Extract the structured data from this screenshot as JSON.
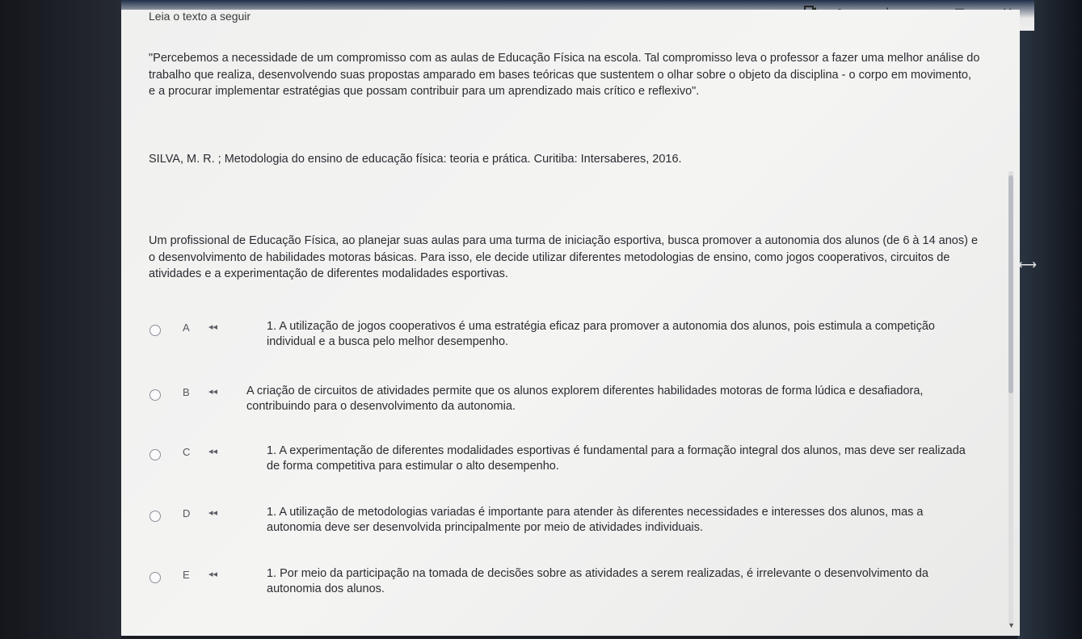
{
  "window": {
    "controls": {
      "cast_icon": "cast-icon",
      "account_icon": "account-icon",
      "menu_icon": "⋮",
      "minimize": "–",
      "maximize": "▢",
      "close": "✕"
    }
  },
  "content": {
    "intro_label": "Leia o texto a seguir",
    "quote": "\"Percebemos a necessidade de um compromisso com as aulas de Educação Física na escola. Tal compromisso leva o professor a fazer uma melhor análise do trabalho que realiza, desenvolvendo suas propostas amparado em bases teóricas que sustentem o olhar sobre o objeto da disciplina - o corpo em movimento, e a procurar implementar estratégias que possam contribuir para um aprendizado mais crítico e reflexivo\".",
    "citation": "SILVA, M. R. ; Metodologia do ensino de educação física: teoria e prática. Curitiba: Intersaberes, 2016.",
    "question": "Um profissional de Educação Física, ao planejar suas aulas para uma turma de iniciação esportiva, busca promover a autonomia dos alunos (de 6 à 14 anos) e o desenvolvimento de habilidades motoras básicas. Para isso, ele decide utilizar diferentes metodologias de ensino, como jogos cooperativos, circuitos de atividades e a experimentação de diferentes modalidades esportivas."
  },
  "options": [
    {
      "letter": "A",
      "text": "1. A utilização de jogos cooperativos é uma estratégia eficaz para promover a autonomia dos alunos, pois estimula a competição individual e a busca pelo melhor desempenho."
    },
    {
      "letter": "B",
      "text": "A criação de circuitos de atividades permite que os alunos explorem diferentes habilidades motoras de forma lúdica e desafiadora, contribuindo para o desenvolvimento da autonomia."
    },
    {
      "letter": "C",
      "text": "1. A experimentação de diferentes modalidades esportivas é fundamental para a formação integral dos alunos, mas deve ser realizada de forma competitiva para estimular o alto desempenho."
    },
    {
      "letter": "D",
      "text": "1. A utilização de metodologias variadas é importante para atender às diferentes necessidades e interesses dos alunos, mas a autonomia deve ser desenvolvida principalmente por meio de atividades individuais."
    },
    {
      "letter": "E",
      "text": "1. Por meio da participação na tomada de decisões sobre as atividades a serem realizadas, é irrelevante o desenvolvimento da autonomia dos alunos."
    }
  ],
  "icons": {
    "speaker": "◂◂",
    "scroll_down": "▼",
    "resize": "⟷"
  }
}
